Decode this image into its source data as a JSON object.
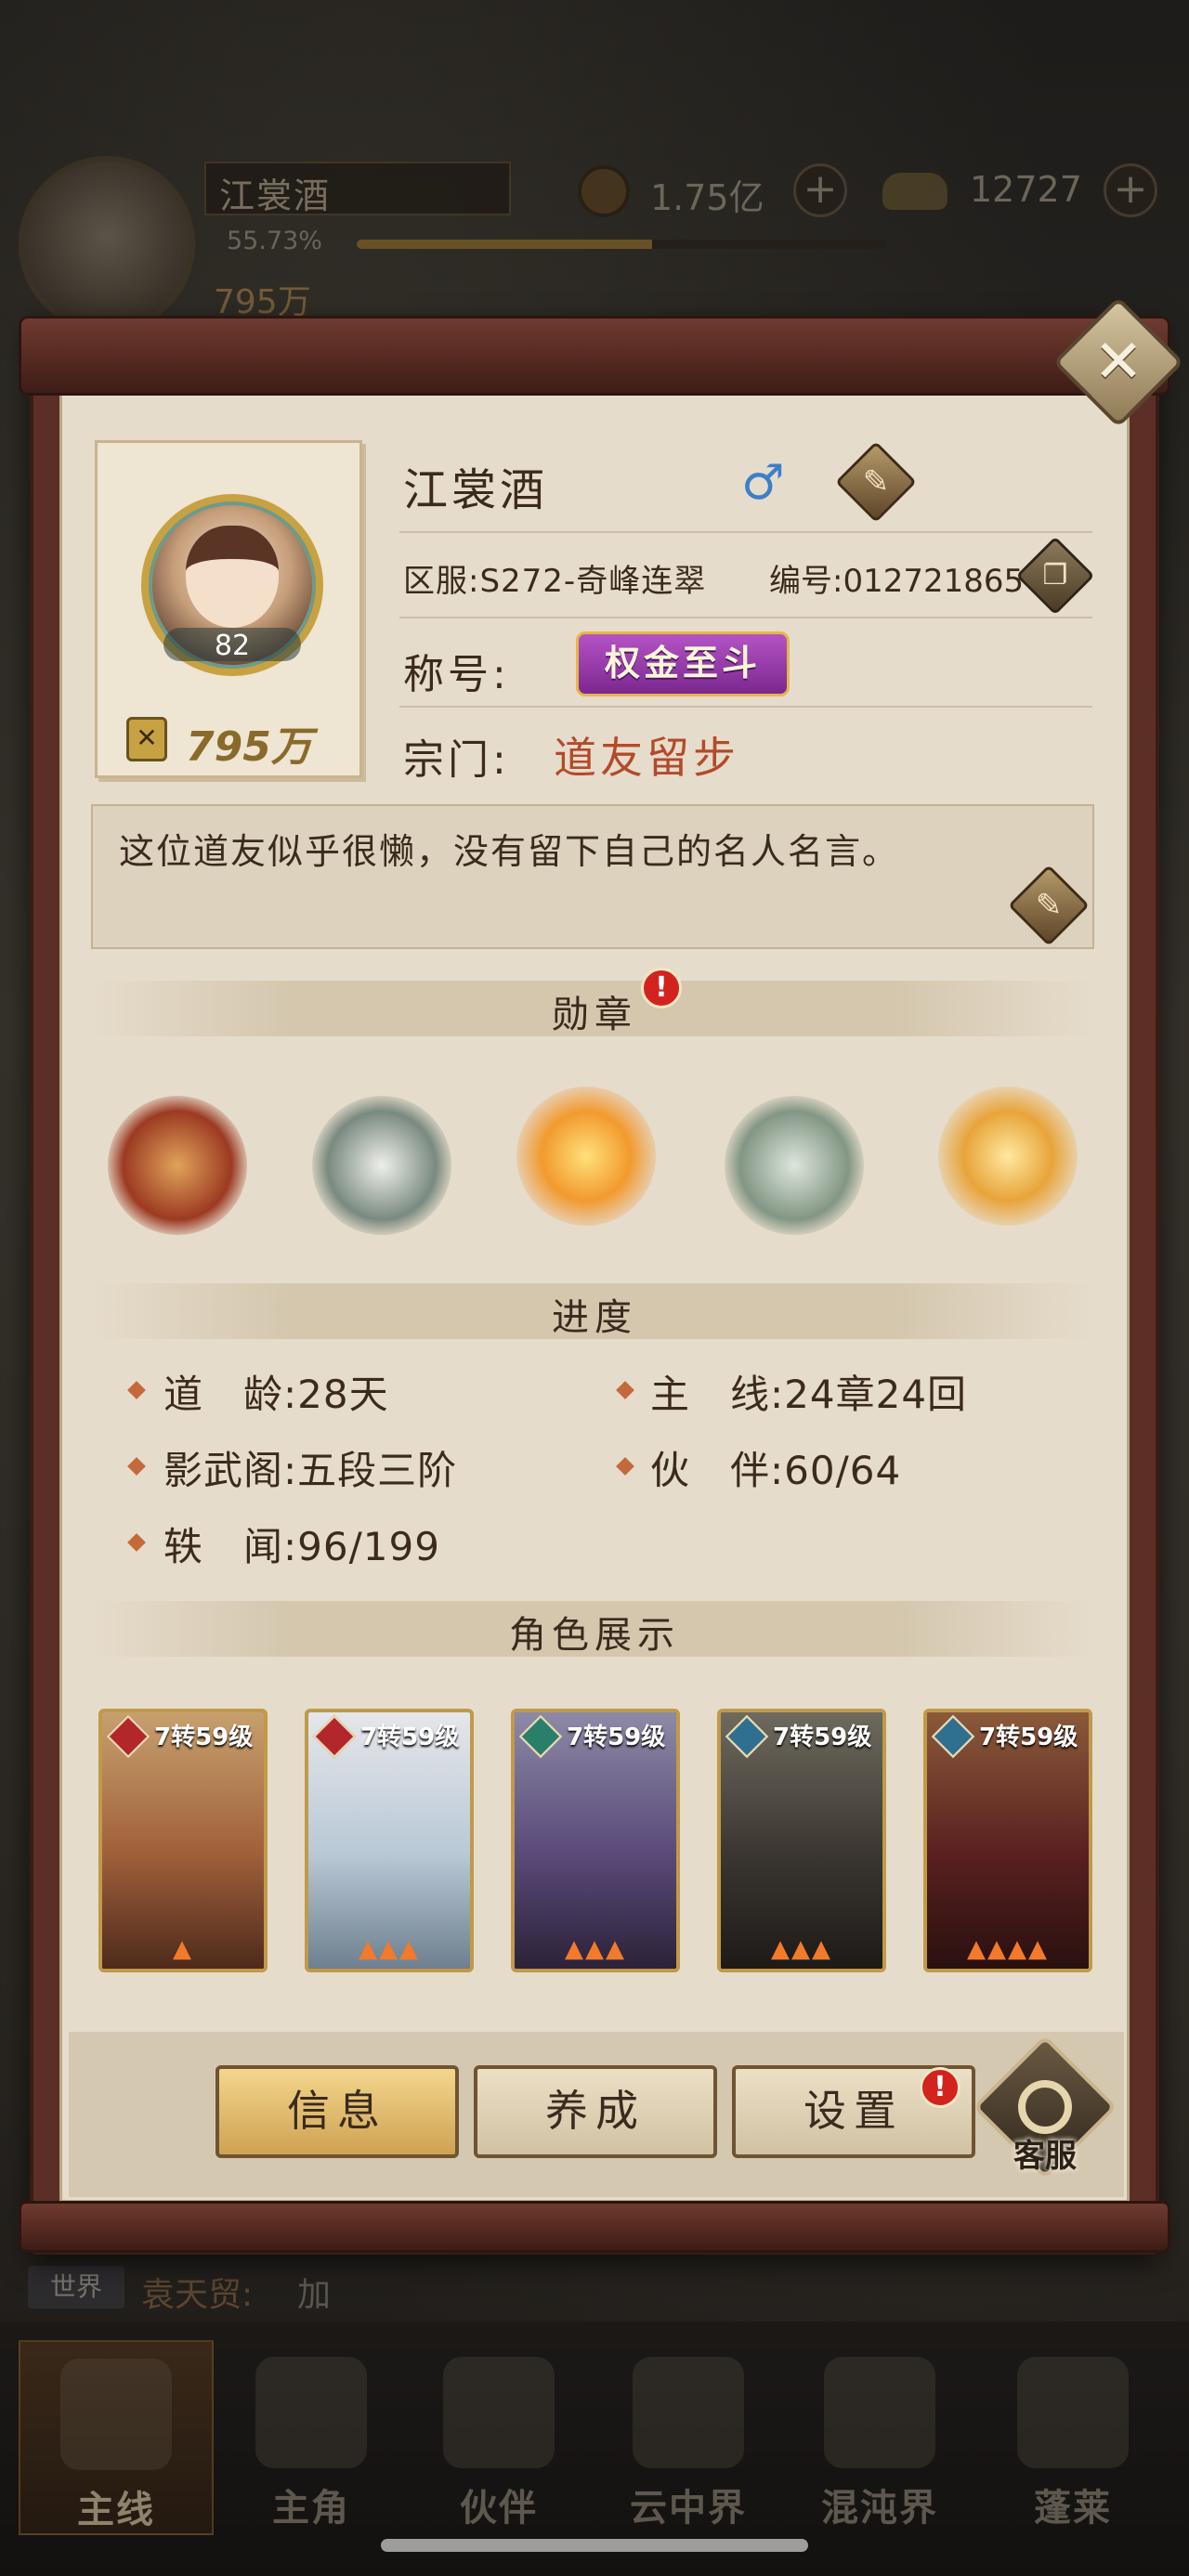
{
  "hud": {
    "player_name": "江裳酒",
    "exp_percent": "55.73%",
    "exp_progress": 0.5573,
    "power": "795万",
    "coins": "1.75亿",
    "ingots": "12727",
    "avatar_level": "82",
    "plus": "+"
  },
  "profile": {
    "name": "江裳酒",
    "gender_symbol": "♂",
    "server": "区服:S272-奇峰连翠",
    "id": "编号:012721865",
    "title_label": "称号:",
    "title_badge": "权金至斗",
    "sect_label": "宗门:",
    "sect_value": "道友留步",
    "level": "82",
    "power": "795万",
    "motto": "这位道友似乎很懒，没有留下自己的名人名言。"
  },
  "sections": {
    "medals": "勋章",
    "progress": "进度",
    "showcase": "角色展示"
  },
  "alert": "!",
  "stats": {
    "dao_age_label": "道　龄:",
    "dao_age_value": "28天",
    "main_line_label": "主　线:",
    "main_line_value": "24章24回",
    "shadow_pavilion_label": "影武阁:",
    "shadow_pavilion_value": "五段三阶",
    "partners_label": "伙　伴:",
    "partners_value": "60/64",
    "anecdotes_label": "轶　闻:",
    "anecdotes_value": "96/199"
  },
  "characters": [
    {
      "level": "7转59级",
      "element_color": "#b3262a",
      "stars": 1
    },
    {
      "level": "7转59级",
      "element_color": "#b3262a",
      "stars": 3
    },
    {
      "level": "7转59级",
      "element_color": "#2a7f6a",
      "stars": 3
    },
    {
      "level": "7转59级",
      "element_color": "#2f6f8f",
      "stars": 3
    },
    {
      "level": "7转59级",
      "element_color": "#2f6f8f",
      "stars": 4
    }
  ],
  "buttons": {
    "info": "信息",
    "cultivate": "养成",
    "settings": "设置",
    "customer_service": "客服",
    "close": "✕"
  },
  "chat": {
    "channel": "世界",
    "sender": "袁天贸:",
    "message": "加"
  },
  "nav": {
    "main_line": "主线",
    "hero": "主角",
    "partner": "伙伴",
    "cloud_realm": "云中界",
    "chaos_realm": "混沌界",
    "penglai": "蓬莱"
  },
  "colors": {
    "panel_frame": "#5c2f26",
    "paper": "#e6dccb",
    "accent_gold": "#c7a243",
    "sect_red": "#b34a2a",
    "alert_red": "#d3231e",
    "male_blue": "#3c7fc9"
  }
}
